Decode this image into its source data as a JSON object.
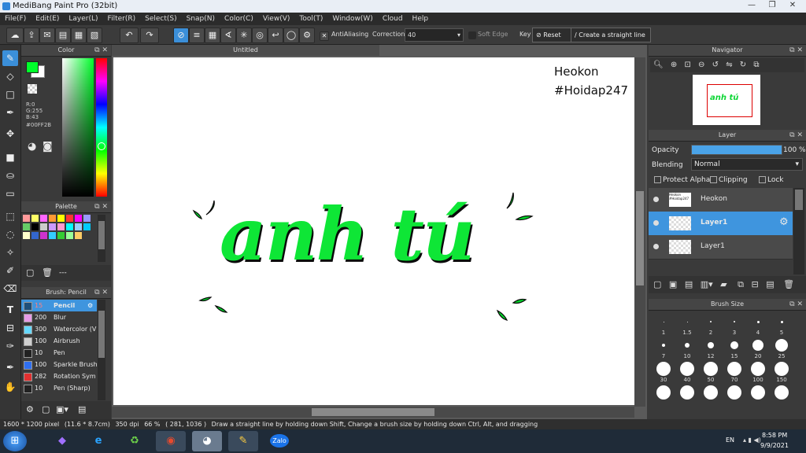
{
  "window": {
    "title": "MediBang Paint Pro (32bit)",
    "min": "—",
    "max": "❐",
    "close": "✕"
  },
  "menu": [
    "File(F)",
    "Edit(E)",
    "Layer(L)",
    "Filter(R)",
    "Select(S)",
    "Snap(N)",
    "Color(C)",
    "View(V)",
    "Tool(T)",
    "Window(W)",
    "Cloud",
    "Help"
  ],
  "toolbar": {
    "antialiasing_label": "AntiAliasing",
    "correction_label": "Correction",
    "correction_value": "40",
    "soft_edge_label": "Soft Edge",
    "key_label": "Key",
    "reset_label": "Reset",
    "straight_line_label": "Create a straight line"
  },
  "color_panel": {
    "title": "Color",
    "r": "R:0",
    "g": "G:255",
    "b": "B:43",
    "hex": "#00FF2B",
    "fg_color": "#00ff2b"
  },
  "palette_panel": {
    "title": "Palette",
    "swatches": [
      "#ff9999",
      "#ffff66",
      "#ff66ff",
      "#ff9933",
      "#ffff00",
      "#ff3333",
      "#ff00ff",
      "#9999ff",
      "#66cc66",
      "#000000",
      "#cccccc",
      "#cc99ff",
      "#ff99cc",
      "#00ffff",
      "#99ccff",
      "#00ccff",
      "#ffffcc",
      "#3366cc",
      "#cc33cc",
      "#33ccff",
      "#33cc33",
      "#99ff99",
      "#ffcc66"
    ],
    "dashes": "---"
  },
  "brush_panel": {
    "title": "Brush: Pencil",
    "brushes": [
      {
        "size": "15",
        "name": "Pencil",
        "color": "#1e4f7a",
        "active": true
      },
      {
        "size": "200",
        "name": "Blur",
        "color": "#e79be7"
      },
      {
        "size": "300",
        "name": "Watercolor (V",
        "color": "#66d9ff"
      },
      {
        "size": "100",
        "name": "Airbrush",
        "color": "#d0d0d0"
      },
      {
        "size": "10",
        "name": "Pen",
        "color": "#222222"
      },
      {
        "size": "100",
        "name": "Sparkle Brush",
        "color": "#2f6ff0"
      },
      {
        "size": "282",
        "name": "Rotation Sym",
        "color": "#e03030"
      },
      {
        "size": "10",
        "name": "Pen (Sharp)",
        "color": "#222222"
      }
    ]
  },
  "document": {
    "tab": "Untitled",
    "signature": "Heokon",
    "hashtag": "#Hoidap247",
    "art_text": "anh tú"
  },
  "navigator": {
    "title": "Navigator",
    "thumb_text": "anh tú"
  },
  "layer_panel": {
    "title": "Layer",
    "opacity_label": "Opacity",
    "opacity_value": "100 %",
    "opacity_fraction": 1.0,
    "blending_label": "Blending",
    "blending_value": "Normal",
    "protect_alpha": "Protect Alpha",
    "clipping": "Clipping",
    "lock": "Lock",
    "layers": [
      {
        "name": "Heokon",
        "thumb": "Heokon #Hoidap247"
      },
      {
        "name": "Layer1",
        "active": true
      },
      {
        "name": "Layer1"
      }
    ]
  },
  "brush_size_panel": {
    "title": "Brush Size",
    "row1": [
      ".",
      ".",
      ".",
      ".",
      ".",
      "."
    ],
    "labels1": [
      "1",
      "1.5",
      "2",
      "3",
      "4",
      "5"
    ],
    "labels2": [
      "7",
      "10",
      "12",
      "15",
      "20",
      "25"
    ],
    "labels3": [
      "30",
      "40",
      "50",
      "70",
      "100",
      "150"
    ]
  },
  "status": {
    "size": "1600 * 1200 pixel",
    "physical": "(11.6 * 8.7cm)",
    "dpi": "350 dpi",
    "zoom": "66 %",
    "coords": "( 281, 1036 )",
    "hint": "Draw a straight line by holding down Shift, Change a brush size by holding down Ctrl, Alt, and dragging"
  },
  "taskbar": {
    "lang": "EN",
    "time": "8:58 PM",
    "date": "9/9/2021",
    "zalo": "Zalo"
  }
}
